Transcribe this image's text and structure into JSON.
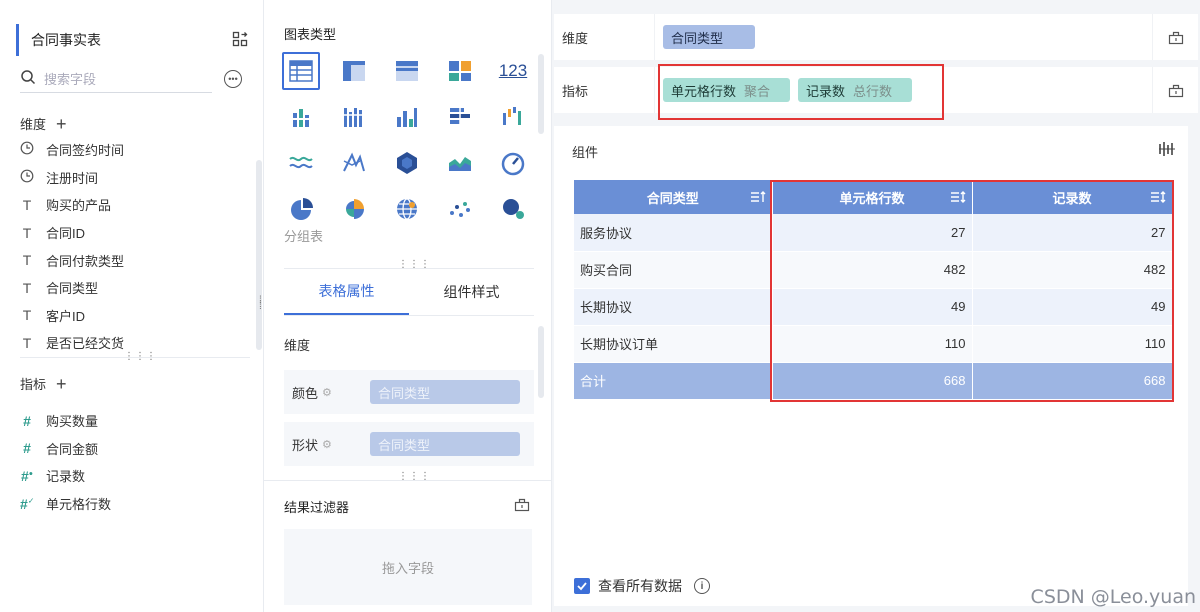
{
  "left_panel": {
    "dataset_name": "合同事实表",
    "search_placeholder": "搜索字段",
    "dimensions_header": "维度",
    "dimensions": [
      {
        "label": "合同签约时间",
        "type": "time"
      },
      {
        "label": "注册时间",
        "type": "time"
      },
      {
        "label": "购买的产品",
        "type": "text"
      },
      {
        "label": "合同ID",
        "type": "text"
      },
      {
        "label": "合同付款类型",
        "type": "text"
      },
      {
        "label": "合同类型",
        "type": "text"
      },
      {
        "label": "客户ID",
        "type": "text"
      },
      {
        "label": "是否已经交货",
        "type": "text"
      }
    ],
    "measures_header": "指标",
    "measures": [
      {
        "label": "购买数量",
        "type": "number"
      },
      {
        "label": "合同金额",
        "type": "number"
      },
      {
        "label": "记录数",
        "type": "count"
      },
      {
        "label": "单元格行数",
        "type": "cellcount"
      }
    ]
  },
  "middle_panel": {
    "chart_types_title": "图表类型",
    "chart_types": [
      {
        "icon": "grouped-table-icon",
        "selected": true
      },
      {
        "icon": "detail-table-icon"
      },
      {
        "icon": "cross-table-icon"
      },
      {
        "icon": "treemap-table-icon"
      },
      {
        "icon": "kpi-number-icon",
        "text": "123"
      },
      {
        "icon": "stacked-column-icon"
      },
      {
        "icon": "multi-column-icon"
      },
      {
        "icon": "column-chart-icon"
      },
      {
        "icon": "bar-chart-icon"
      },
      {
        "icon": "waterfall-icon"
      },
      {
        "icon": "line-chart-icon"
      },
      {
        "icon": "radar-icon"
      },
      {
        "icon": "polygon-map-icon"
      },
      {
        "icon": "area-chart-icon"
      },
      {
        "icon": "gauge-icon"
      },
      {
        "icon": "pie-chart-icon"
      },
      {
        "icon": "rose-chart-icon"
      },
      {
        "icon": "globe-map-icon"
      },
      {
        "icon": "scatter-icon"
      },
      {
        "icon": "bubble-icon"
      }
    ],
    "selected_chart_caption": "分组表",
    "tabs": [
      {
        "label": "表格属性",
        "active": true
      },
      {
        "label": "组件样式",
        "active": false
      }
    ],
    "dimension_label": "维度",
    "props": [
      {
        "label": "颜色",
        "value": "合同类型"
      },
      {
        "label": "形状",
        "value": "合同类型"
      }
    ],
    "filter_title": "结果过滤器",
    "filter_placeholder": "拖入字段"
  },
  "right_panel": {
    "dimension_shelf_label": "维度",
    "dimension_pill": "合同类型",
    "indicator_shelf_label": "指标",
    "indicator_pills": [
      {
        "name": "单元格行数",
        "agg": "聚合"
      },
      {
        "name": "记录数",
        "agg": "总行数"
      }
    ],
    "component_title": "组件",
    "table": {
      "headers": [
        "合同类型",
        "单元格行数",
        "记录数"
      ],
      "rows": [
        [
          "服务协议",
          "27",
          "27"
        ],
        [
          "购买合同",
          "482",
          "482"
        ],
        [
          "长期协议",
          "49",
          "49"
        ],
        [
          "长期协议订单",
          "110",
          "110"
        ]
      ],
      "total": [
        "合计",
        "668",
        "668"
      ]
    },
    "view_all_label": "查看所有数据"
  },
  "watermark": "CSDN @Leo.yuan",
  "colors": {
    "accent": "#3d6fd8",
    "header_blue": "#6a8fd6",
    "dimension_pill": "#a8bde6",
    "indicator_pill": "#a8dfd6",
    "highlight_red": "#e23535"
  }
}
